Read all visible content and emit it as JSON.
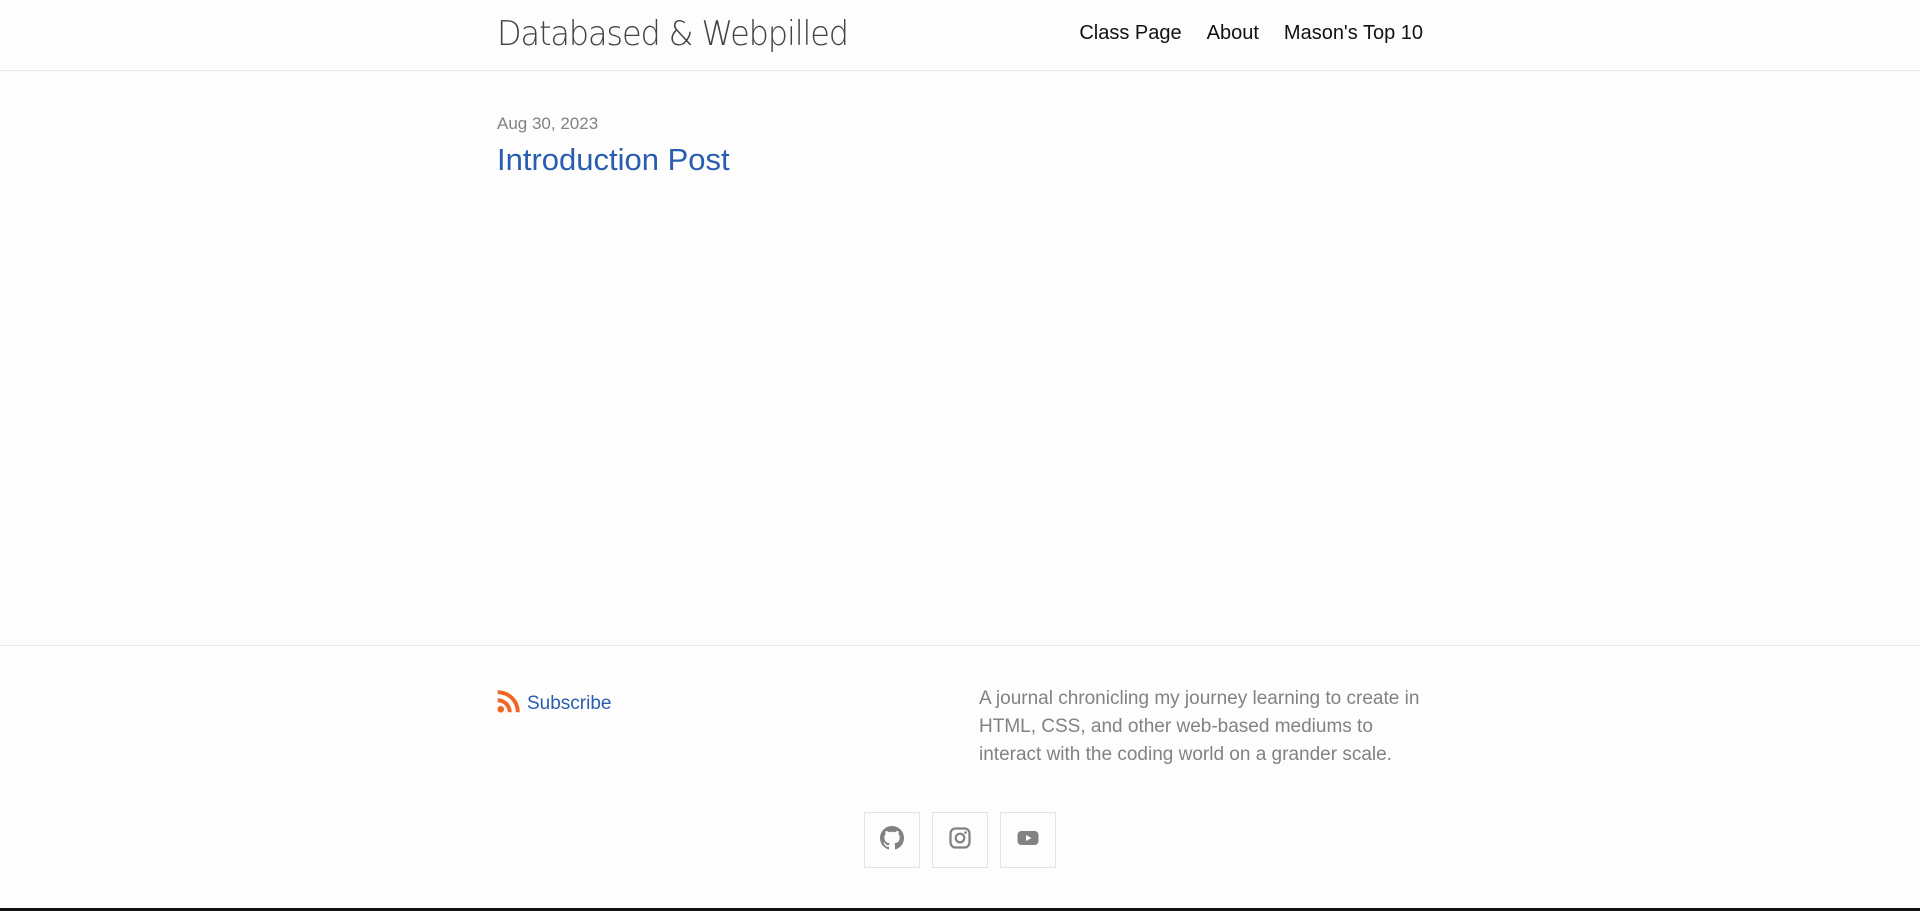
{
  "header": {
    "site_title": "Databased & Webpilled",
    "nav": [
      {
        "label": "Class Page"
      },
      {
        "label": "About"
      },
      {
        "label": "Mason's Top 10"
      }
    ]
  },
  "posts": [
    {
      "date": "Aug 30, 2023",
      "title": "Introduction Post"
    }
  ],
  "footer": {
    "subscribe_label": "Subscribe",
    "description": "A journal chronicling my journey learning to create in HTML, CSS, and other web-based mediums to interact with the coding world on a grander scale.",
    "social": [
      {
        "icon": "github-icon"
      },
      {
        "icon": "instagram-icon"
      },
      {
        "icon": "youtube-icon"
      }
    ]
  },
  "colors": {
    "link": "#2a5db0",
    "muted": "#828282",
    "rss": "#f26522",
    "icon": "#828282"
  }
}
